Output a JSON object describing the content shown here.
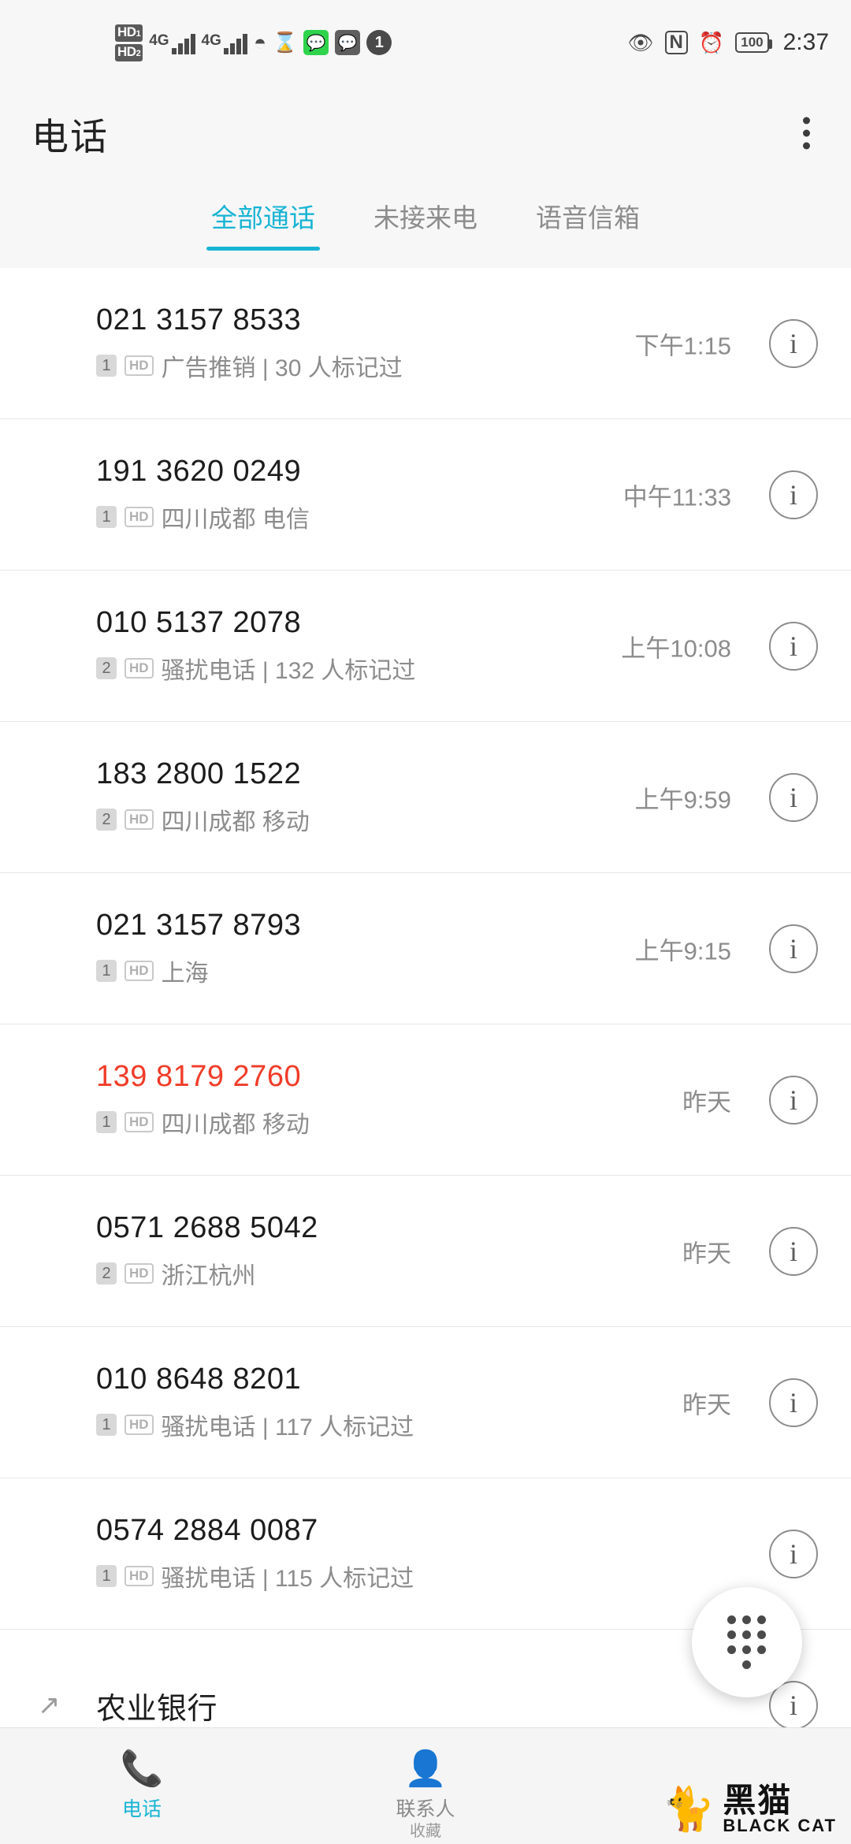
{
  "statusbar": {
    "hd1": "HD",
    "hd1_sub": "1",
    "hd2": "HD",
    "hd2_sub": "2",
    "net1": "4G",
    "net2": "4G",
    "wifi_icon": "wifi-icon",
    "hourglass_icon": "hourglass-icon",
    "wechat_icon": "wechat-icon",
    "wechat_alt_icon": "wechat-alt-icon",
    "notif_badge": "1",
    "eye_icon": "eye-icon",
    "nfc": "N",
    "alarm_icon": "alarm-icon",
    "battery": "100",
    "clock": "2:37"
  },
  "header": {
    "title": "电话",
    "more_icon": "more-vertical-icon"
  },
  "tabs": [
    {
      "label": "全部通话",
      "active": true
    },
    {
      "label": "未接来电",
      "active": false
    },
    {
      "label": "语音信箱",
      "active": false
    }
  ],
  "calls": [
    {
      "number": "021 3157 8533",
      "count": "1",
      "hd": "HD",
      "detail": "广告推销 | 30 人标记过",
      "time": "下午1:15",
      "missed": false,
      "outgoing": false,
      "info": "i"
    },
    {
      "number": "191 3620 0249",
      "count": "1",
      "hd": "HD",
      "detail": "四川成都 电信",
      "time": "中午11:33",
      "missed": false,
      "outgoing": false,
      "info": "i"
    },
    {
      "number": "010 5137 2078",
      "count": "2",
      "hd": "HD",
      "detail": "骚扰电话 | 132 人标记过",
      "time": "上午10:08",
      "missed": false,
      "outgoing": false,
      "info": "i"
    },
    {
      "number": "183 2800 1522",
      "count": "2",
      "hd": "HD",
      "detail": "四川成都 移动",
      "time": "上午9:59",
      "missed": false,
      "outgoing": false,
      "info": "i"
    },
    {
      "number": "021 3157 8793",
      "count": "1",
      "hd": "HD",
      "detail": "上海",
      "time": "上午9:15",
      "missed": false,
      "outgoing": false,
      "info": "i"
    },
    {
      "number": "139 8179 2760",
      "count": "1",
      "hd": "HD",
      "detail": "四川成都 移动",
      "time": "昨天",
      "missed": true,
      "outgoing": false,
      "info": "i"
    },
    {
      "number": "0571 2688 5042",
      "count": "2",
      "hd": "HD",
      "detail": "浙江杭州",
      "time": "昨天",
      "missed": false,
      "outgoing": false,
      "info": "i"
    },
    {
      "number": "010 8648 8201",
      "count": "1",
      "hd": "HD",
      "detail": "骚扰电话 | 117 人标记过",
      "time": "昨天",
      "missed": false,
      "outgoing": false,
      "info": "i"
    },
    {
      "number": "0574 2884 0087",
      "count": "1",
      "hd": "HD",
      "detail": "骚扰电话 | 115 人标记过",
      "time": "",
      "missed": false,
      "outgoing": false,
      "info": "i"
    },
    {
      "number": "农业银行",
      "count": "",
      "hd": "",
      "detail": "",
      "time": "",
      "missed": false,
      "outgoing": true,
      "info": "i"
    }
  ],
  "fab": {
    "icon": "dialpad-icon"
  },
  "bottomnav": [
    {
      "label": "电话",
      "icon": "phone-icon",
      "active": true
    },
    {
      "label": "联系人",
      "icon": "contacts-icon",
      "active": false
    }
  ],
  "watermark": {
    "cat_icon": "black-cat-logo",
    "cn": "黑猫",
    "en": "BLACK CAT",
    "collect": "收藏"
  },
  "colors": {
    "accent": "#18b4d4",
    "missed": "#f03c28",
    "chrome": "#f7f7f7"
  }
}
